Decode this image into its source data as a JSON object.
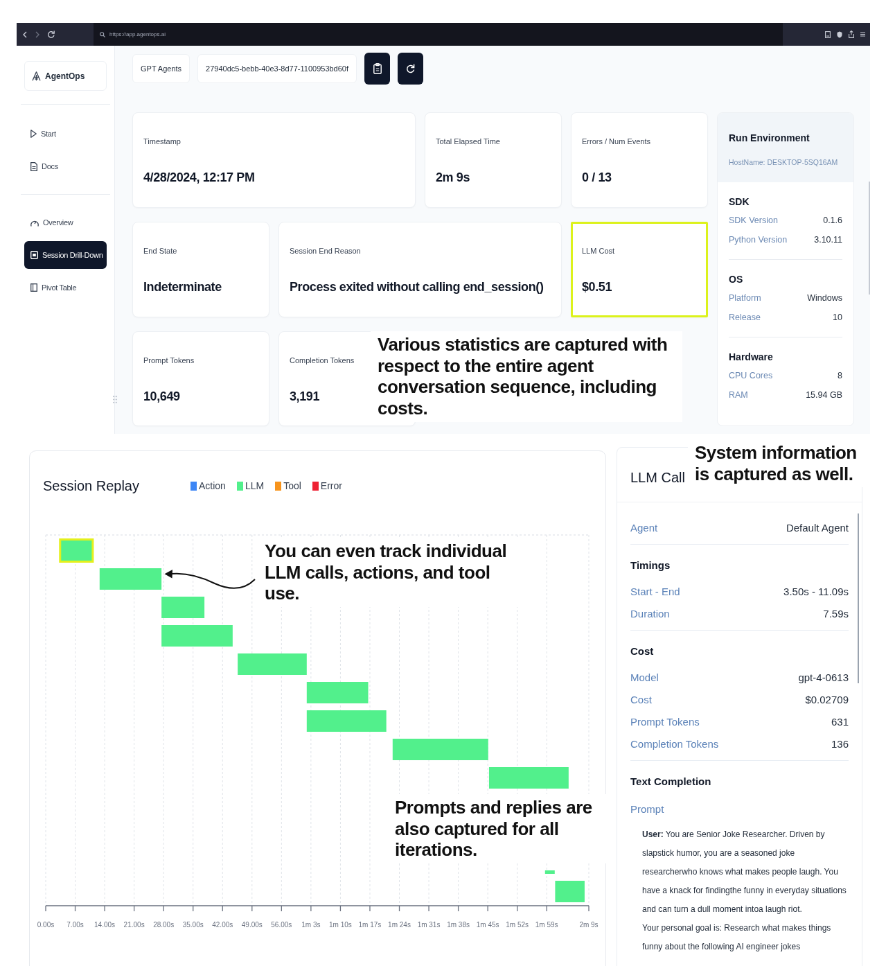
{
  "browser": {
    "url": "https://app.agentops.ai"
  },
  "sidebar": {
    "logo": "AgentOps",
    "groups": [
      {
        "items": [
          {
            "label": "Start",
            "selected": false
          },
          {
            "label": "Docs",
            "selected": false
          }
        ]
      },
      {
        "items": [
          {
            "label": "Overview",
            "selected": false
          },
          {
            "label": "Session Drill-Down",
            "selected": true
          },
          {
            "label": "Pivot Table",
            "selected": false
          }
        ]
      }
    ]
  },
  "header": {
    "project": "GPT Agents",
    "session_id": "27940dc5-bebb-40e3-8d77-1100953bd60f"
  },
  "stats": [
    {
      "label": "Timestamp",
      "value": "4/28/2024, 12:17 PM",
      "highlighted": false
    },
    {
      "label": "Total Elapsed Time",
      "value": "2m 9s",
      "highlighted": false
    },
    {
      "label": "Errors / Num Events",
      "value": "0 / 13",
      "highlighted": false
    },
    {
      "label": "End State",
      "value": "Indeterminate",
      "highlighted": false
    },
    {
      "label": "Session End Reason",
      "value": "Process exited without calling end_session()",
      "highlighted": false
    },
    {
      "label": "LLM Cost",
      "value": "$0.51",
      "highlighted": true
    },
    {
      "label": "Prompt Tokens",
      "value": "10,649",
      "highlighted": false
    },
    {
      "label": "Completion Tokens",
      "value": "3,191",
      "highlighted": false
    }
  ],
  "run_environment": {
    "title": "Run Environment",
    "hostname": "HostName: DESKTOP-5SQ16AM",
    "sections": [
      {
        "title": "SDK",
        "rows": [
          {
            "label": "SDK Version",
            "value": "0.1.6"
          },
          {
            "label": "Python Version",
            "value": "3.10.11"
          }
        ]
      },
      {
        "title": "OS",
        "rows": [
          {
            "label": "Platform",
            "value": "Windows"
          },
          {
            "label": "Release",
            "value": "10"
          }
        ]
      },
      {
        "title": "Hardware",
        "rows": [
          {
            "label": "CPU Cores",
            "value": "8"
          },
          {
            "label": "RAM",
            "value": "15.94 GB"
          }
        ]
      }
    ]
  },
  "session_replay": {
    "title": "Session Replay",
    "legend": [
      {
        "label": "Action",
        "color": "#3d86f5"
      },
      {
        "label": "LLM",
        "color": "#52f08c"
      },
      {
        "label": "Tool",
        "color": "#f7941d"
      },
      {
        "label": "Error",
        "color": "#ee2233"
      }
    ],
    "events": [
      {
        "kind": "llm",
        "selected": true
      },
      {
        "kind": "llm",
        "selected": false
      },
      {
        "kind": "llm",
        "selected": false
      },
      {
        "kind": "llm",
        "selected": false
      },
      {
        "kind": "llm",
        "selected": false
      },
      {
        "kind": "llm",
        "selected": false
      },
      {
        "kind": "llm",
        "selected": false
      },
      {
        "kind": "llm",
        "selected": false
      },
      {
        "kind": "llm",
        "selected": false
      },
      {
        "kind": "llm",
        "selected": false
      },
      {
        "kind": "llm",
        "selected": false
      }
    ],
    "axis_labels": [
      "0.00s",
      "7.00s",
      "14.00s",
      "21.00s",
      "28.00s",
      "35.00s",
      "42.00s",
      "49.00s",
      "56.00s",
      "1m 3s",
      "1m 10s",
      "1m 17s",
      "1m 24s",
      "1m 31s",
      "1m 38s",
      "1m 45s",
      "1m 52s",
      "1m 59s",
      "2m 9s"
    ]
  },
  "llm_call": {
    "title": "LLM Call",
    "sections": [
      {
        "rows": [
          {
            "label": "Agent",
            "value": "Default Agent"
          }
        ]
      },
      {
        "title": "Timings",
        "rows": [
          {
            "label": "Start - End",
            "value": "3.50s - 11.09s"
          },
          {
            "label": "Duration",
            "value": "7.59s"
          }
        ]
      },
      {
        "title": "Cost",
        "rows": [
          {
            "label": "Model",
            "value": "gpt-4-0613"
          },
          {
            "label": "Cost",
            "value": "$0.02709"
          },
          {
            "label": "Prompt Tokens",
            "value": "631"
          },
          {
            "label": "Completion Tokens",
            "value": "136"
          }
        ]
      }
    ],
    "text_completion": {
      "title": "Text Completion",
      "label": "Prompt",
      "paragraphs": [
        "**User:** You are Senior Joke Researcher. Driven by slapstick humor, you are a seasoned joke researcherwho knows what makes people laugh. You have a knack for findingthe funny in everyday situations and can turn a dull moment intoa laugh riot.",
        "Your personal goal is: Research what makes things funny about the following AI engineer jokes"
      ]
    }
  },
  "annotations": [
    {
      "text": "Various statistics are captured with respect to the entire agent conversation sequence, including costs."
    },
    {
      "text": "System information is captured as well."
    },
    {
      "text": "You can even track individual LLM calls, actions, and tool use."
    },
    {
      "text": "Prompts and replies are also captured for all iterations."
    }
  ]
}
